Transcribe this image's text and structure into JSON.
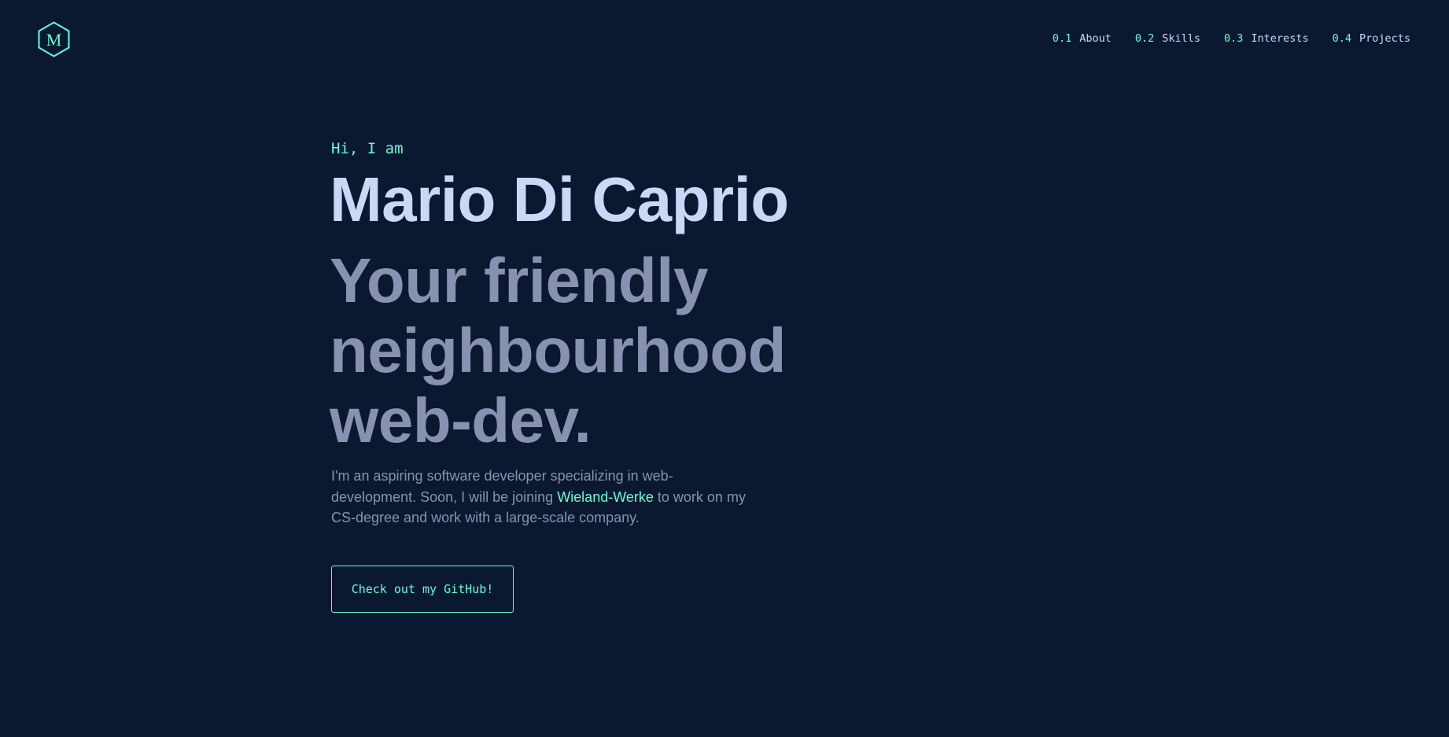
{
  "logo": {
    "letter": "M",
    "icon": "hexagon-logo-icon"
  },
  "nav": {
    "items": [
      {
        "num": "0.1",
        "label": "About"
      },
      {
        "num": "0.2",
        "label": "Skills"
      },
      {
        "num": "0.3",
        "label": "Interests"
      },
      {
        "num": "0.4",
        "label": "Projects"
      }
    ]
  },
  "hero": {
    "greeting": "Hi, I am",
    "name": "Mario Di Caprio",
    "tagline_lines": [
      "Your friendly",
      "neighbourhood",
      "web-dev."
    ],
    "intro": {
      "line1": "I'm an aspiring software developer specializing in web-",
      "line2_before": "development. Soon, I will be joining ",
      "company": "Wieland-Werke",
      "line2_after": " to work on my",
      "line3": "CS-degree and work with a large-scale company."
    },
    "cta_label": "Check out my GitHub!"
  },
  "colors": {
    "background": "#0a1930",
    "accent": "#64ffda",
    "heading": "#ccd6f6",
    "muted": "#8892b0"
  }
}
